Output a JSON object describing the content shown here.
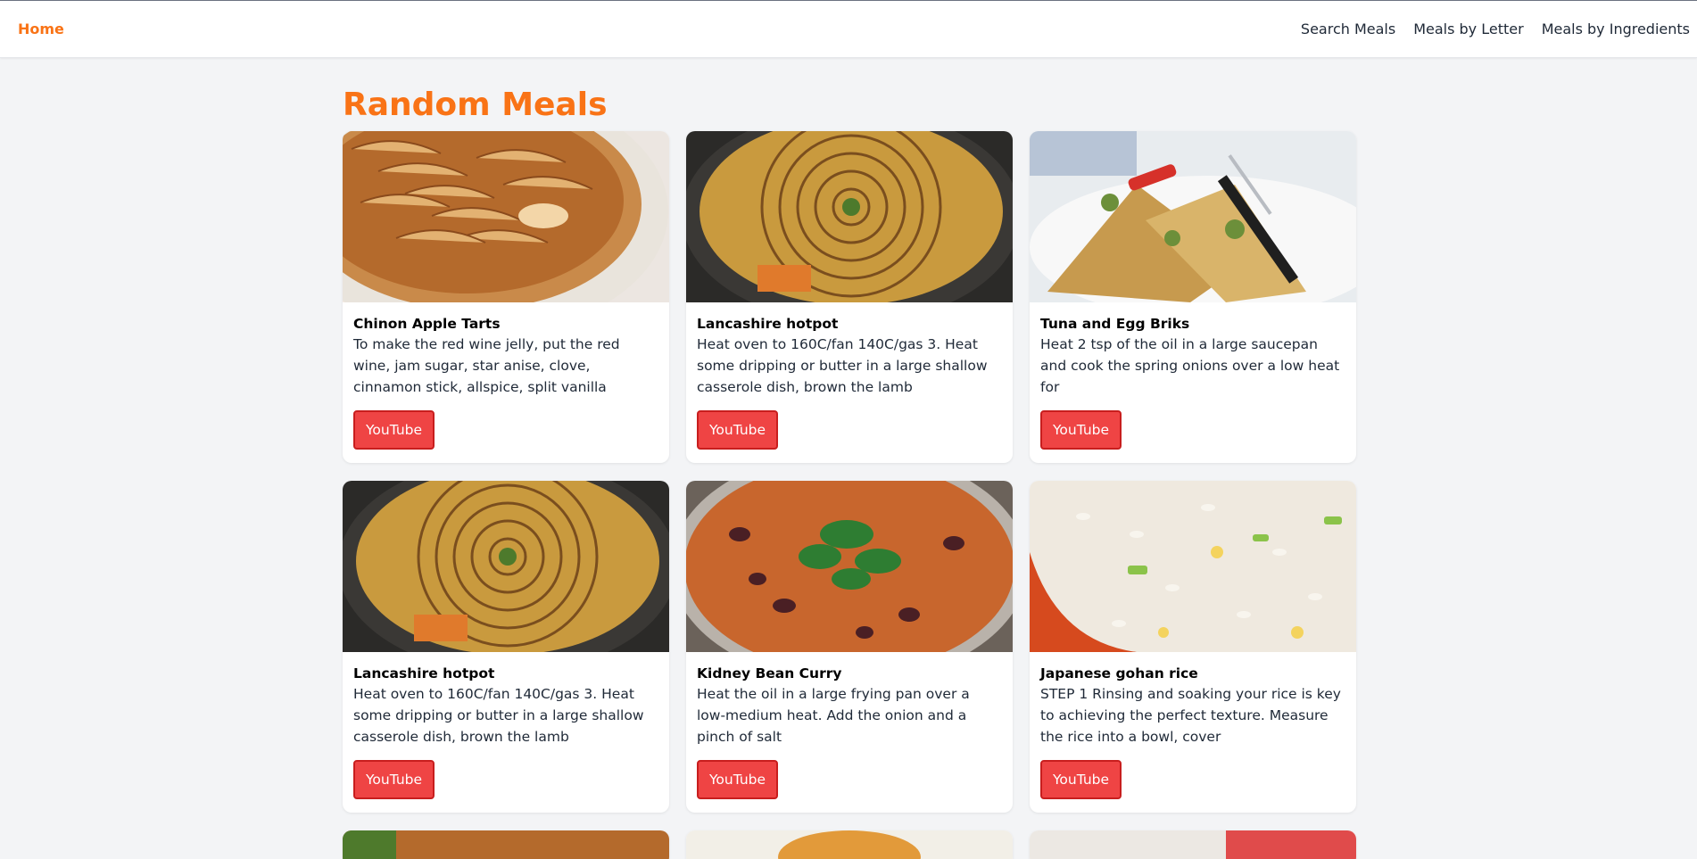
{
  "nav": {
    "home": "Home",
    "links": [
      "Search Meals",
      "Meals by Letter",
      "Meals by Ingredients"
    ]
  },
  "page": {
    "title": "Random Meals"
  },
  "colors": {
    "accent": "#f97316",
    "button": "#ef4444"
  },
  "meals": [
    {
      "title": "Chinon Apple Tarts",
      "desc": "To make the red wine jelly, put the red wine, jam sugar, star anise, clove, cinnamon stick, allspice, split vanilla",
      "button": "YouTube",
      "image": "apple-tart"
    },
    {
      "title": "Lancashire hotpot",
      "desc": "Heat oven to 160C/fan 140C/gas 3. Heat some dripping or butter in a large shallow casserole dish, brown the lamb",
      "button": "YouTube",
      "image": "hotpot"
    },
    {
      "title": "Tuna and Egg Briks",
      "desc": "Heat 2 tsp of the oil in a large saucepan and cook the spring onions over a low heat for",
      "button": "YouTube",
      "image": "briks"
    },
    {
      "title": "Lancashire hotpot",
      "desc": "Heat oven to 160C/fan 140C/gas 3. Heat some dripping or butter in a large shallow casserole dish, brown the lamb",
      "button": "YouTube",
      "image": "hotpot"
    },
    {
      "title": "Kidney Bean Curry",
      "desc": "Heat the oil in a large frying pan over a low-medium heat. Add the onion and a pinch of salt",
      "button": "YouTube",
      "image": "curry"
    },
    {
      "title": "Japanese gohan rice",
      "desc": "STEP 1 Rinsing and soaking your rice is key to achieving the perfect texture. Measure the rice into a bowl, cover",
      "button": "YouTube",
      "image": "rice"
    }
  ]
}
